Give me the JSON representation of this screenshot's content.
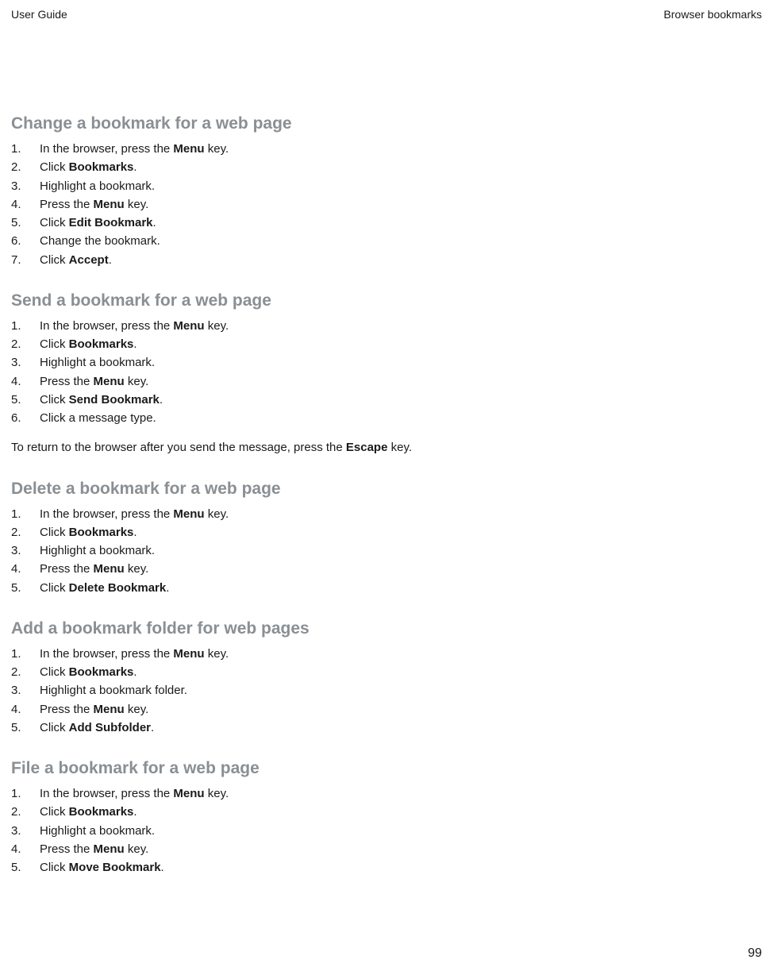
{
  "header": {
    "left": "User Guide",
    "right": "Browser bookmarks"
  },
  "sections": [
    {
      "heading": "Change a bookmark for a web page",
      "steps": [
        {
          "n": "1.",
          "parts": [
            "In the browser, press the ",
            "Menu",
            " key."
          ]
        },
        {
          "n": "2.",
          "parts": [
            "Click ",
            "Bookmarks",
            "."
          ]
        },
        {
          "n": "3.",
          "parts": [
            "Highlight a bookmark."
          ]
        },
        {
          "n": "4.",
          "parts": [
            "Press the ",
            "Menu",
            " key."
          ]
        },
        {
          "n": "5.",
          "parts": [
            "Click ",
            "Edit Bookmark",
            "."
          ]
        },
        {
          "n": "6.",
          "parts": [
            "Change the bookmark."
          ]
        },
        {
          "n": "7.",
          "parts": [
            "Click ",
            "Accept",
            "."
          ]
        }
      ]
    },
    {
      "heading": "Send a bookmark for a web page",
      "steps": [
        {
          "n": "1.",
          "parts": [
            "In the browser, press the ",
            "Menu",
            " key."
          ]
        },
        {
          "n": "2.",
          "parts": [
            "Click ",
            "Bookmarks",
            "."
          ]
        },
        {
          "n": "3.",
          "parts": [
            "Highlight a bookmark."
          ]
        },
        {
          "n": "4.",
          "parts": [
            "Press the ",
            "Menu",
            " key."
          ]
        },
        {
          "n": "5.",
          "parts": [
            "Click ",
            "Send Bookmark",
            "."
          ]
        },
        {
          "n": "6.",
          "parts": [
            "Click a message type."
          ]
        }
      ],
      "note": [
        "To return to the browser after you send the message, press the ",
        "Escape",
        " key."
      ]
    },
    {
      "heading": "Delete a bookmark for a web page",
      "steps": [
        {
          "n": "1.",
          "parts": [
            "In the browser, press the ",
            "Menu",
            " key."
          ]
        },
        {
          "n": "2.",
          "parts": [
            "Click ",
            "Bookmarks",
            "."
          ]
        },
        {
          "n": "3.",
          "parts": [
            "Highlight a bookmark."
          ]
        },
        {
          "n": "4.",
          "parts": [
            "Press the ",
            "Menu",
            " key."
          ]
        },
        {
          "n": "5.",
          "parts": [
            "Click ",
            "Delete Bookmark",
            "."
          ]
        }
      ]
    },
    {
      "heading": "Add a bookmark folder for web pages",
      "steps": [
        {
          "n": "1.",
          "parts": [
            "In the browser, press the ",
            "Menu",
            " key."
          ]
        },
        {
          "n": "2.",
          "parts": [
            "Click ",
            "Bookmarks",
            "."
          ]
        },
        {
          "n": "3.",
          "parts": [
            "Highlight a bookmark folder."
          ]
        },
        {
          "n": "4.",
          "parts": [
            "Press the ",
            "Menu",
            " key."
          ]
        },
        {
          "n": "5.",
          "parts": [
            "Click ",
            "Add Subfolder",
            "."
          ]
        }
      ]
    },
    {
      "heading": "File a bookmark for a web page",
      "steps": [
        {
          "n": "1.",
          "parts": [
            "In the browser, press the ",
            "Menu",
            " key."
          ]
        },
        {
          "n": "2.",
          "parts": [
            "Click ",
            "Bookmarks",
            "."
          ]
        },
        {
          "n": "3.",
          "parts": [
            "Highlight a bookmark."
          ]
        },
        {
          "n": "4.",
          "parts": [
            "Press the ",
            "Menu",
            " key."
          ]
        },
        {
          "n": "5.",
          "parts": [
            "Click ",
            "Move Bookmark",
            "."
          ]
        }
      ]
    }
  ],
  "page_number": "99"
}
